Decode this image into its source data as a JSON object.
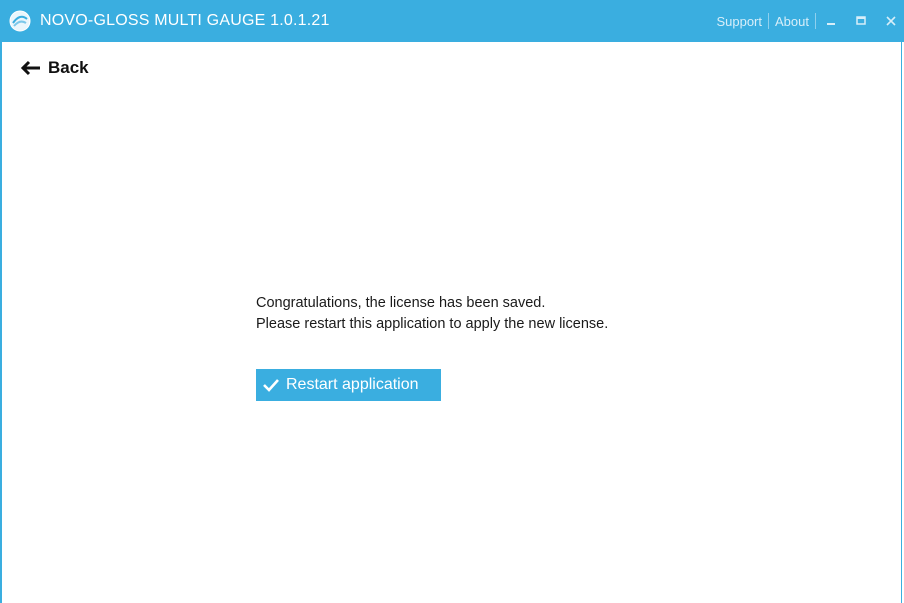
{
  "window": {
    "title": "NOVO-GLOSS MULTI GAUGE 1.0.1.21",
    "icon": "app-logo-icon",
    "links": {
      "support": "Support",
      "about": "About"
    },
    "controls": [
      "minimize-icon",
      "maximize-icon",
      "close-icon"
    ]
  },
  "nav": {
    "back_label": "Back",
    "back_icon": "arrow-left-icon"
  },
  "content": {
    "line1": "Congratulations, the license has been saved.",
    "line2": "Please restart this application to apply the new license.",
    "restart_label": "Restart application",
    "restart_icon": "checkmark-icon"
  },
  "colors": {
    "accent": "#3aaee0",
    "text": "#1a1a1a",
    "background": "#ffffff"
  }
}
